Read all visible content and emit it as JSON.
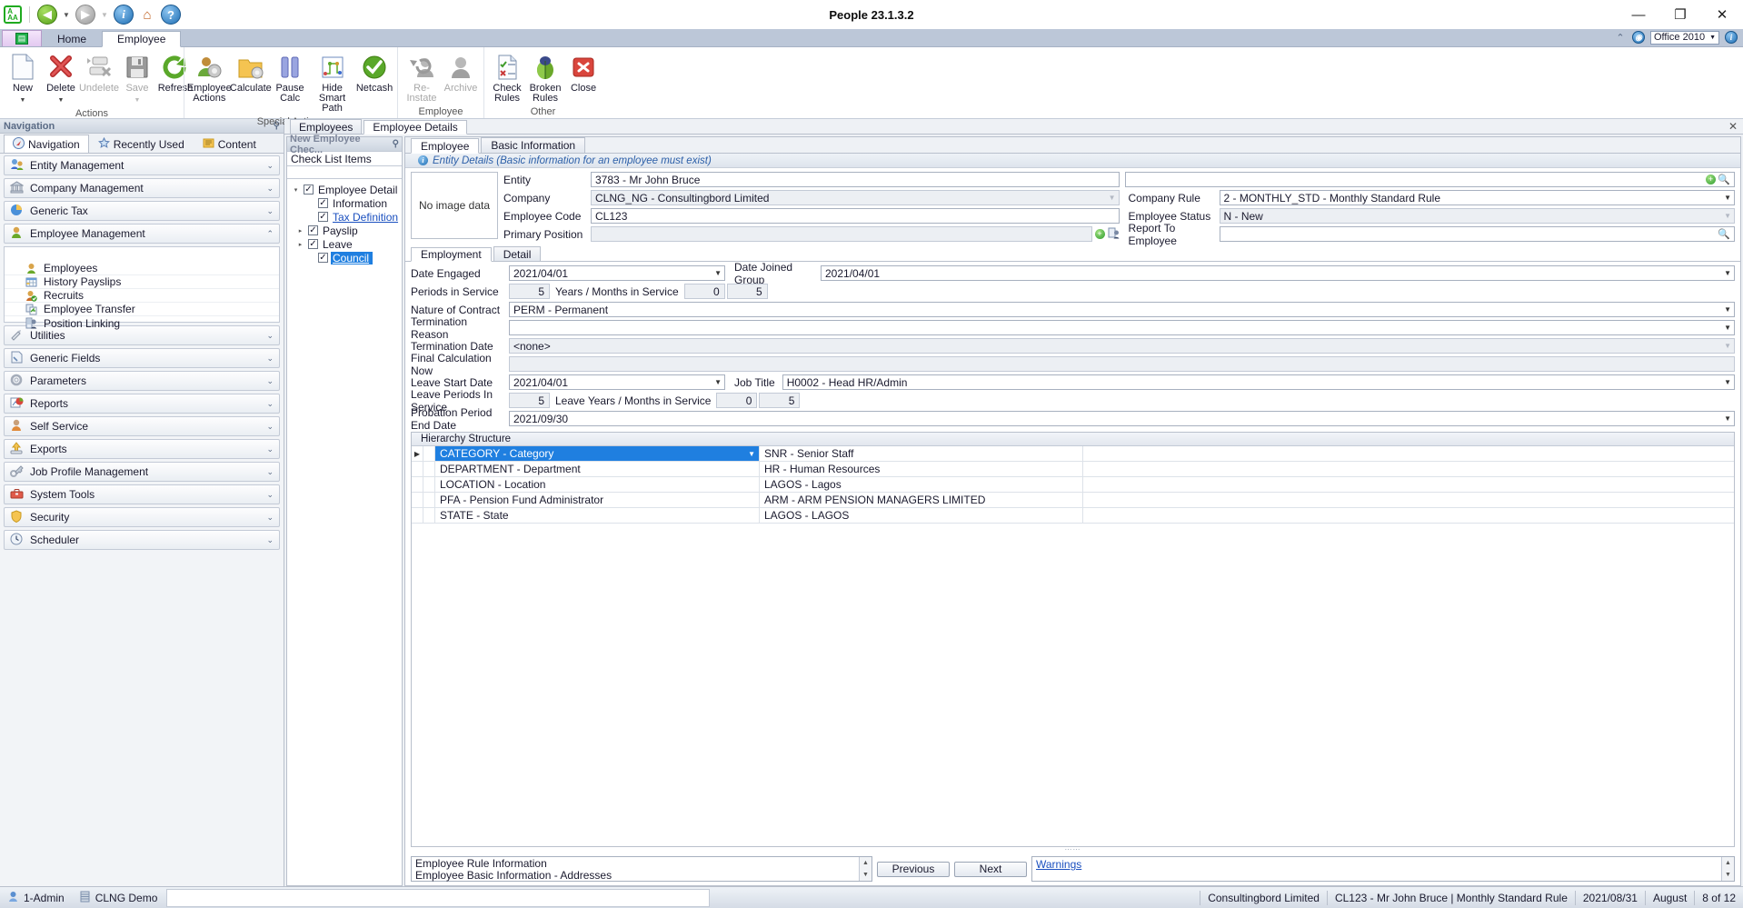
{
  "window": {
    "title": "People 23.1.3.2",
    "minimize": "—",
    "maximize": "❐",
    "close": "✕"
  },
  "quick_access": {
    "back": "◀",
    "forward": "▶",
    "info": "i",
    "home": "⌂",
    "help": "?"
  },
  "ribbon": {
    "tabs": [
      {
        "label": "Home",
        "active": false
      },
      {
        "label": "Employee",
        "active": true
      }
    ],
    "right": {
      "collapse": "⌃",
      "style_value": "Office 2010",
      "style_arrow": "▼",
      "help": "i"
    },
    "groups": [
      {
        "label": "Actions",
        "commands": [
          {
            "label": "New",
            "icon": "new-document-icon",
            "dropdown": "▼",
            "disabled": false
          },
          {
            "label": "Delete",
            "icon": "delete-x-icon",
            "dropdown": "▼",
            "disabled": false
          },
          {
            "label": "Undelete",
            "icon": "undelete-icon",
            "dropdown": "",
            "disabled": true
          },
          {
            "label": "Save",
            "icon": "save-disk-icon",
            "dropdown": "▼",
            "disabled": true
          },
          {
            "label": "Refresh",
            "icon": "refresh-arrow-icon",
            "dropdown": "",
            "disabled": false
          }
        ]
      },
      {
        "label": "Special Actions",
        "commands": [
          {
            "label": "Employee\nActions",
            "icon": "employee-actions-icon",
            "dropdown": "▼",
            "disabled": false
          },
          {
            "label": "Calculate",
            "icon": "calculate-folder-icon",
            "dropdown": "",
            "disabled": false
          },
          {
            "label": "Pause\nCalc",
            "icon": "pause-icon",
            "dropdown": "",
            "disabled": false
          },
          {
            "label": "Hide Smart\nPath",
            "icon": "smart-path-icon",
            "dropdown": "",
            "disabled": false
          },
          {
            "label": "Netcash",
            "icon": "netcash-check-icon",
            "dropdown": "",
            "disabled": false
          }
        ]
      },
      {
        "label": "Employee",
        "commands": [
          {
            "label": "Re-Instate",
            "icon": "reinstate-icon",
            "dropdown": "",
            "disabled": true
          },
          {
            "label": "Archive",
            "icon": "archive-person-icon",
            "dropdown": "",
            "disabled": true
          }
        ]
      },
      {
        "label": "Other",
        "commands": [
          {
            "label": "Check\nRules",
            "icon": "check-rules-icon",
            "dropdown": "",
            "disabled": false
          },
          {
            "label": "Broken\nRules",
            "icon": "broken-rules-bug-icon",
            "dropdown": "",
            "disabled": false
          },
          {
            "label": "Close",
            "icon": "close-red-icon",
            "dropdown": "",
            "disabled": false
          }
        ]
      }
    ]
  },
  "navigation": {
    "header": "Navigation",
    "pin": "📌",
    "tabs": [
      {
        "label": "Navigation",
        "icon": "compass-icon",
        "active": true
      },
      {
        "label": "Recently Used",
        "icon": "star-icon",
        "active": false
      },
      {
        "label": "Content",
        "icon": "content-book-icon",
        "active": false
      }
    ],
    "groups": [
      {
        "label": "Entity Management",
        "icon": "entity-people-icon",
        "chevron": "⌄",
        "expanded": false
      },
      {
        "label": "Company Management",
        "icon": "company-bank-icon",
        "chevron": "⌄",
        "expanded": false
      },
      {
        "label": "Generic Tax",
        "icon": "generic-tax-pie-icon",
        "chevron": "⌄",
        "expanded": false
      },
      {
        "label": "Employee Management",
        "icon": "employee-person-icon",
        "chevron": "⌃",
        "expanded": true
      },
      {
        "label": "Utilities",
        "icon": "utilities-tools-icon",
        "chevron": "⌄",
        "expanded": false
      },
      {
        "label": "Generic Fields",
        "icon": "generic-fields-icon",
        "chevron": "⌄",
        "expanded": false
      },
      {
        "label": "Parameters",
        "icon": "parameters-gear-icon",
        "chevron": "⌄",
        "expanded": false
      },
      {
        "label": "Reports",
        "icon": "reports-chart-icon",
        "chevron": "⌄",
        "expanded": false
      },
      {
        "label": "Self Service",
        "icon": "self-service-person-icon",
        "chevron": "⌄",
        "expanded": false
      },
      {
        "label": "Exports",
        "icon": "exports-upload-icon",
        "chevron": "⌄",
        "expanded": false
      },
      {
        "label": "Job Profile Management",
        "icon": "job-profile-key-icon",
        "chevron": "⌄",
        "expanded": false
      },
      {
        "label": "System Tools",
        "icon": "system-tools-toolbox-icon",
        "chevron": "⌄",
        "expanded": false
      },
      {
        "label": "Security",
        "icon": "security-shield-icon",
        "chevron": "⌄",
        "expanded": false
      },
      {
        "label": "Scheduler",
        "icon": "scheduler-clock-icon",
        "chevron": "⌄",
        "expanded": false
      }
    ],
    "employee_items": [
      {
        "label": "Employees",
        "icon": "employee-person-icon"
      },
      {
        "label": "History Payslips",
        "icon": "payslip-grid-icon"
      },
      {
        "label": "Recruits",
        "icon": "recruits-icon"
      },
      {
        "label": "Employee Transfer",
        "icon": "transfer-icon"
      },
      {
        "label": "Position Linking",
        "icon": "position-linking-icon"
      }
    ]
  },
  "doc_tabs": [
    {
      "label": "Employees",
      "active": false
    },
    {
      "label": "Employee Details",
      "active": true
    }
  ],
  "doc_close": "✕",
  "checklist": {
    "title": "New Employee Chec...",
    "pin": "📌",
    "subtitle": "Check List Items",
    "items": [
      {
        "label": "Employee Detail",
        "checked": true,
        "expander": "▾",
        "indent": 0,
        "style": "plain"
      },
      {
        "label": "Information",
        "checked": true,
        "expander": "",
        "indent": 1,
        "style": "plain"
      },
      {
        "label": "Tax Definition",
        "checked": true,
        "expander": "",
        "indent": 1,
        "style": "link"
      },
      {
        "label": "Payslip",
        "checked": true,
        "expander": "▸",
        "indent": 1,
        "style": "plain"
      },
      {
        "label": "Leave",
        "checked": true,
        "expander": "▸",
        "indent": 1,
        "style": "plain"
      },
      {
        "label": "Council",
        "checked": true,
        "expander": "",
        "indent": 1,
        "style": "selected"
      }
    ]
  },
  "form": {
    "tabs": [
      {
        "label": "Employee",
        "active": true
      },
      {
        "label": "Basic Information",
        "active": false
      }
    ],
    "info_message": "Entity Details (Basic information for an employee must exist)",
    "photo_placeholder": "No image data",
    "entity_fields": {
      "entity_label": "Entity",
      "entity_value": "3783 - Mr John Bruce",
      "company_label": "Company",
      "company_value": "CLNG_NG - Consultingbord Limited",
      "employee_code_label": "Employee Code",
      "employee_code_value": "CL123",
      "primary_position_label": "Primary Position",
      "primary_position_value": "",
      "company_rule_label": "Company Rule",
      "company_rule_value": "2 - MONTHLY_STD - Monthly Standard Rule",
      "employee_status_label": "Employee Status",
      "employee_status_value": "N - New",
      "report_to_label": "Report To Employee",
      "report_to_value": ""
    },
    "employment_tabs": [
      {
        "label": "Employment",
        "active": true
      },
      {
        "label": "Detail",
        "active": false
      }
    ],
    "employment": {
      "date_engaged_label": "Date Engaged",
      "date_engaged_value": "2021/04/01",
      "date_joined_group_label": "Date Joined Group",
      "date_joined_group_value": "2021/04/01",
      "periods_in_service_label": "Periods in Service",
      "periods_in_service_value": "5",
      "years_months_label": "Years / Months in Service",
      "years_value": "0",
      "months_value": "5",
      "nature_of_contract_label": "Nature of Contract",
      "nature_of_contract_value": "PERM - Permanent",
      "termination_reason_label": "Termination Reason",
      "termination_reason_value": "",
      "termination_date_label": "Termination Date",
      "termination_date_value": "<none>",
      "final_calculation_label": "Final Calculation Now",
      "final_calculation_value": "",
      "leave_start_date_label": "Leave Start Date",
      "leave_start_date_value": "2021/04/01",
      "job_title_label": "Job Title",
      "job_title_value": "H0002 - Head HR/Admin",
      "leave_periods_label": "Leave Periods In Service",
      "leave_periods_value": "5",
      "leave_years_months_label": "Leave Years / Months in Service",
      "leave_years_value": "0",
      "leave_months_value": "5",
      "probation_end_label": "Probation Period End Date",
      "probation_end_value": "2021/09/30"
    },
    "hierarchy": {
      "title": "Hierarchy Structure",
      "rows": [
        {
          "type": "CATEGORY - Category",
          "value": "SNR - Senior Staff",
          "selected": true
        },
        {
          "type": "DEPARTMENT - Department",
          "value": "HR - Human Resources",
          "selected": false
        },
        {
          "type": "LOCATION - Location",
          "value": "LAGOS - Lagos",
          "selected": false
        },
        {
          "type": "PFA - Pension Fund Administrator",
          "value": "ARM - ARM PENSION MANAGERS LIMITED",
          "selected": false
        },
        {
          "type": "STATE - State",
          "value": "LAGOS - LAGOS",
          "selected": false
        }
      ]
    },
    "messages": [
      "Employee Rule Information",
      "Employee Basic Information - Addresses"
    ],
    "previous_button": "Previous",
    "next_button": "Next",
    "warnings_link": "Warnings"
  },
  "statusbar": {
    "user": "1-Admin",
    "user_icon": "user-icon",
    "database": "CLNG  Demo",
    "database_icon": "database-icon",
    "company": "Consultingbord Limited",
    "employee": "CL123 - Mr John Bruce | Monthly Standard Rule",
    "date": "2021/08/31",
    "month": "August",
    "period": "8 of 12"
  }
}
